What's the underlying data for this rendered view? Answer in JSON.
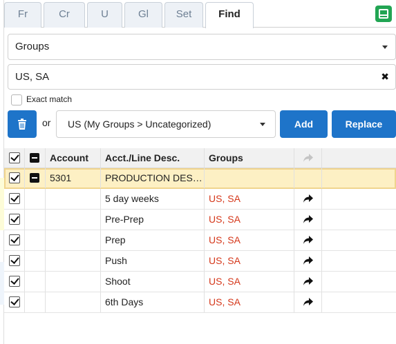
{
  "tabs": [
    {
      "label": "Fr",
      "active": false
    },
    {
      "label": "Cr",
      "active": false
    },
    {
      "label": "U",
      "active": false
    },
    {
      "label": "Gl",
      "active": false
    },
    {
      "label": "Set",
      "active": false
    },
    {
      "label": "Find",
      "active": true
    }
  ],
  "panel_toggle_icon": "panel-icon",
  "group_select": {
    "value": "Groups"
  },
  "search": {
    "value": "US, SA",
    "clear_icon": "✖"
  },
  "exact_match": {
    "label": "Exact match",
    "checked": false
  },
  "actions": {
    "delete_icon": "trash-icon",
    "or_label": "or",
    "target_select_value": "US (My Groups > Uncategorized)",
    "add_label": "Add",
    "replace_label": "Replace"
  },
  "table": {
    "headers": {
      "account": "Account",
      "desc": "Acct./Line Desc.",
      "groups": "Groups"
    },
    "parent": {
      "account": "5301",
      "desc": "PRODUCTION DESIGN",
      "groups": ""
    },
    "rows": [
      {
        "desc": "5 day weeks",
        "groups": "US, SA"
      },
      {
        "desc": "Pre-Prep",
        "groups": "US, SA"
      },
      {
        "desc": "Prep",
        "groups": "US, SA"
      },
      {
        "desc": "Push",
        "groups": "US, SA"
      },
      {
        "desc": "Shoot",
        "groups": "US, SA"
      },
      {
        "desc": "6th Days",
        "groups": "US, SA"
      }
    ]
  },
  "colors": {
    "accent_blue": "#1e74c9",
    "green": "#22a553",
    "group_red": "#d5371a",
    "parent_row": "#fdf0c4"
  }
}
